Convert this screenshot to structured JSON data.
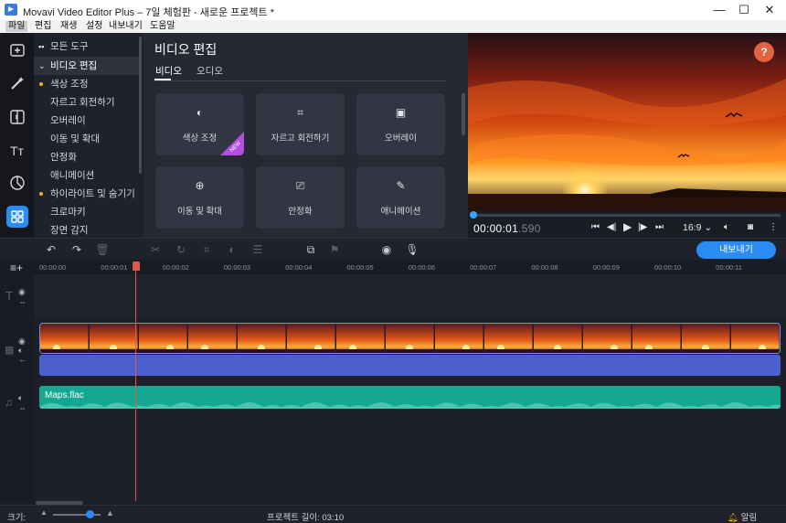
{
  "window": {
    "title": "Movavi Video Editor Plus – 7일 체험판 - 새로운 프로젝트 *",
    "minimize": "—",
    "maximize": "☐",
    "close": "✕"
  },
  "menu": [
    "파일",
    "편집",
    "재생",
    "설정",
    "내보내기",
    "도움말"
  ],
  "sidebar_icons": [
    "import-icon",
    "magic-wand-icon",
    "transitions-icon",
    "titles-icon",
    "stickers-icon",
    "more-tools-icon"
  ],
  "tools_list": {
    "all_tools": "모든 도구",
    "section": "비디오 편집",
    "items": [
      "색상 조정",
      "자르고 회전하기",
      "오버레이",
      "이동 및 확대",
      "안정화",
      "애니메이션",
      "하이라이트 및 숨기기",
      "크로마키",
      "장면 감지"
    ],
    "dotted": [
      true,
      false,
      false,
      false,
      false,
      false,
      true,
      false,
      false
    ]
  },
  "tools_panel": {
    "title": "비디오 편집",
    "tabs": [
      "비디오",
      "오디오"
    ],
    "cards": [
      {
        "label": "색상 조정",
        "icon": "◐",
        "badge": "NEW"
      },
      {
        "label": "자르고 회전하기",
        "icon": "⌗"
      },
      {
        "label": "오버레이",
        "icon": "▣"
      },
      {
        "label": "이동 및 확대",
        "icon": "⊕"
      },
      {
        "label": "안정화",
        "icon": "⎚"
      },
      {
        "label": "애니메이션",
        "icon": "✎"
      }
    ]
  },
  "preview": {
    "help": "?",
    "time_main": "00:00:01",
    "time_ms": ".590",
    "ratio": "16:9 ⌄"
  },
  "timeline": {
    "export_label": "내보내기",
    "ruler": [
      "00:00:00",
      "00:00:01",
      "00:00:02",
      "00:00:03",
      "00:00:04",
      "00:00:05",
      "00:00:06",
      "00:00:07",
      "00:00:08",
      "00:00:09",
      "00:00:10",
      "00:00:11"
    ],
    "audio_clip": "Maps.flac",
    "frames": 15
  },
  "status": {
    "size_label": "크기:",
    "project_length": "프로젝트 길이: 03:10",
    "notifications": "알림"
  },
  "colors": {
    "accent": "#2a8cf4",
    "playhead": "#e2574c",
    "music": "#14a892",
    "audio_track": "#4c5fcf",
    "new_badge": "#b44ee0"
  }
}
